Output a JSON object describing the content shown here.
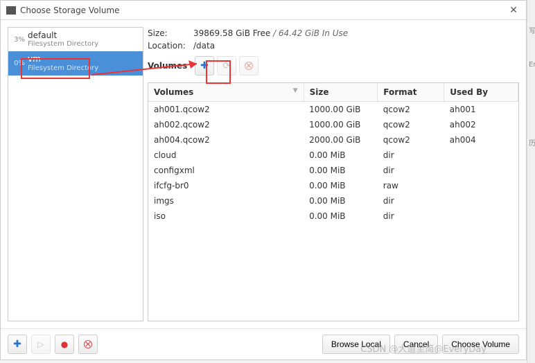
{
  "window": {
    "title": "Choose Storage Volume"
  },
  "pools": [
    {
      "pct": "3%",
      "name": "default",
      "sub": "Filesystem Directory",
      "selected": false
    },
    {
      "pct": "0%",
      "name": "vm",
      "sub": "Filesystem Directory",
      "selected": true
    }
  ],
  "info": {
    "size_label": "Size:",
    "size_free": "39869.58 GiB Free",
    "size_sep": " / ",
    "size_used": "64.42 GiB In Use",
    "location_label": "Location:",
    "location_value": "/data"
  },
  "volumes": {
    "header_label": "Volumes",
    "columns": {
      "vol": "Volumes",
      "size": "Size",
      "format": "Format",
      "usedby": "Used By"
    },
    "rows": [
      {
        "vol": "ah001.qcow2",
        "size": "1000.00 GiB",
        "format": "qcow2",
        "usedby": "ah001"
      },
      {
        "vol": "ah002.qcow2",
        "size": "1000.00 GiB",
        "format": "qcow2",
        "usedby": "ah002"
      },
      {
        "vol": "ah004.qcow2",
        "size": "2000.00 GiB",
        "format": "qcow2",
        "usedby": "ah004"
      },
      {
        "vol": "cloud",
        "size": "0.00 MiB",
        "format": "dir",
        "usedby": ""
      },
      {
        "vol": "configxml",
        "size": "0.00 MiB",
        "format": "dir",
        "usedby": ""
      },
      {
        "vol": "ifcfg-br0",
        "size": "0.00 MiB",
        "format": "raw",
        "usedby": ""
      },
      {
        "vol": "imgs",
        "size": "0.00 MiB",
        "format": "dir",
        "usedby": ""
      },
      {
        "vol": "iso",
        "size": "0.00 MiB",
        "format": "dir",
        "usedby": ""
      }
    ]
  },
  "footer": {
    "browse": "Browse Local",
    "cancel": "Cancel",
    "choose": "Choose Volume"
  },
  "watermark": "CSDN @大道至简@EveryDay",
  "icons": {
    "plus": "✚",
    "refresh": "⟳",
    "delete": "✕",
    "play": "▷",
    "record": "●",
    "close_win": "✕",
    "sort": "▼"
  },
  "sidestrip": {
    "a": "写",
    "b": "En",
    "c": "历"
  }
}
